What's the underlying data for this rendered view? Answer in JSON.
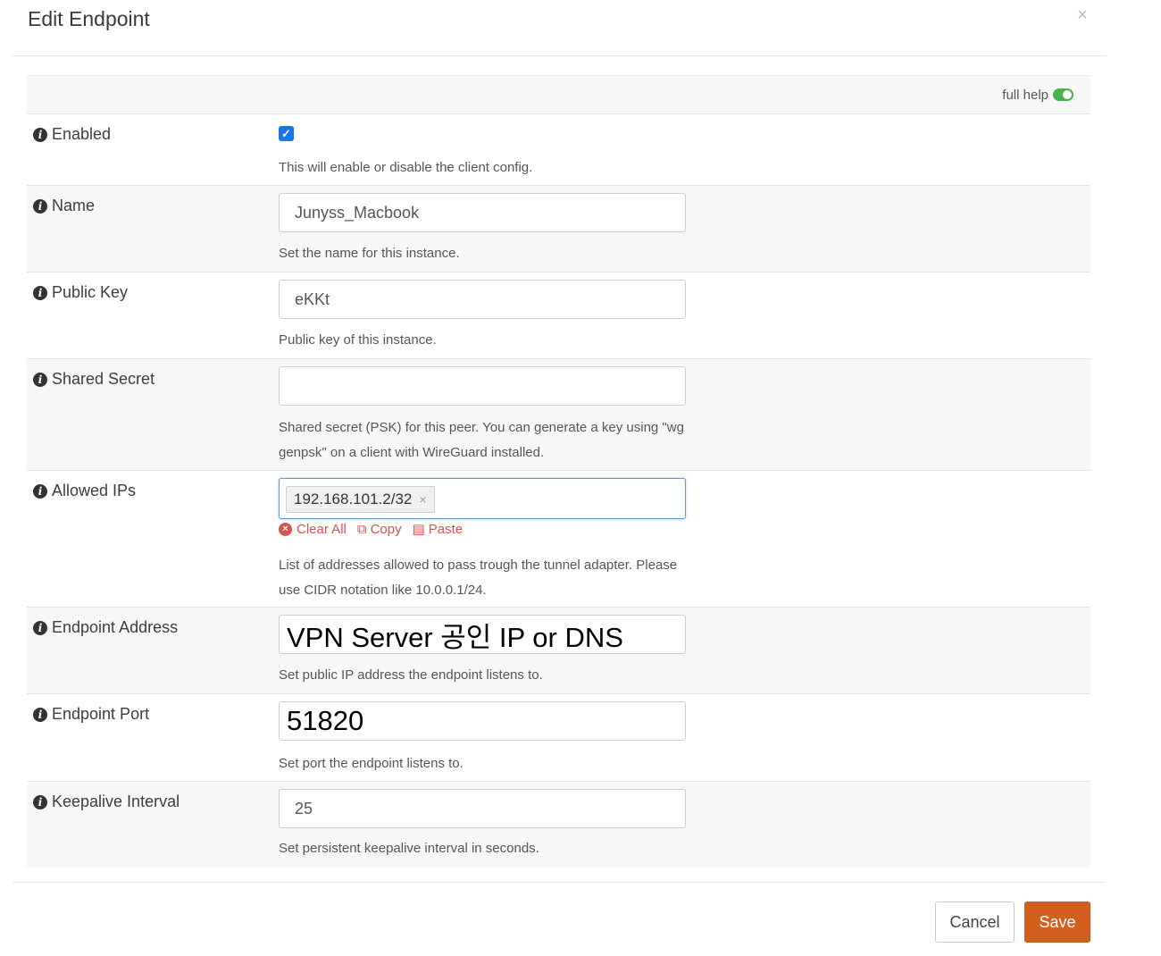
{
  "dialog": {
    "title": "Edit Endpoint",
    "close_glyph": "×"
  },
  "help": {
    "label": "full help",
    "toggle_on": true
  },
  "fields": {
    "enabled": {
      "label": "Enabled",
      "checked": true,
      "hint": "This will enable or disable the client config."
    },
    "name": {
      "label": "Name",
      "value": "Junyss_Macbook",
      "hint": "Set the name for this instance."
    },
    "public_key": {
      "label": "Public Key",
      "value": "eKKt",
      "hint": "Public key of this instance."
    },
    "shared_secret": {
      "label": "Shared Secret",
      "value": "",
      "hint_line1": "Shared secret (PSK) for this peer. You can generate a key using \"wg",
      "hint_line2": "genpsk\" on a client with WireGuard installed."
    },
    "allowed_ips": {
      "label": "Allowed IPs",
      "tags": [
        "192.168.101.2/32"
      ],
      "tag_remove_glyph": "×",
      "clear_all": "Clear All",
      "copy": "Copy",
      "paste": "Paste",
      "hint_line1": "List of addresses allowed to pass trough the tunnel adapter. Please",
      "hint_line2": "use CIDR notation like 10.0.0.1/24."
    },
    "endpoint_address": {
      "label": "Endpoint Address",
      "value": "VPN Server 공인 IP or DNS",
      "hint": "Set public IP address the endpoint listens to."
    },
    "endpoint_port": {
      "label": "Endpoint Port",
      "value": "51820",
      "hint": "Set port the endpoint listens to."
    },
    "keepalive": {
      "label": "Keepalive Interval",
      "value": "25",
      "hint": "Set persistent keepalive interval in seconds."
    }
  },
  "footer": {
    "cancel_label": "Cancel",
    "save_label": "Save"
  },
  "colors": {
    "save_button": "#d35f1f",
    "link_red": "#d9534f",
    "toggle_green": "#4caf50",
    "checkbox_blue": "#1a73e8"
  },
  "icons": {
    "info": "info-circle-icon",
    "clear": "times-circle-icon",
    "copy": "copy-icon",
    "paste": "paste-icon"
  }
}
